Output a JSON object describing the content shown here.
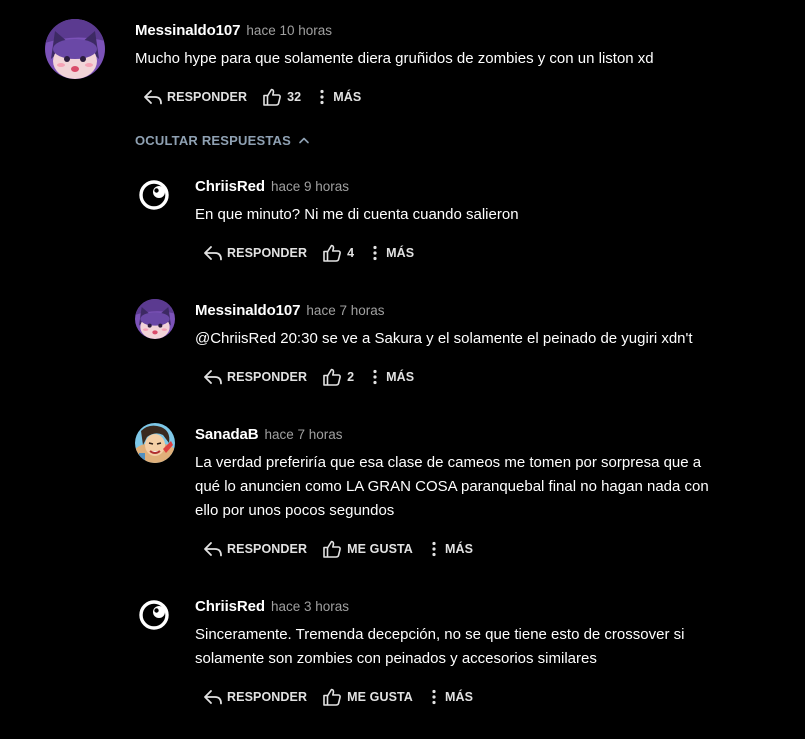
{
  "actions": {
    "reply_label": "RESPONDER",
    "like_label": "ME GUSTA",
    "more_label": "MÁS"
  },
  "toggle_replies": {
    "label": "OCULTAR RESPUESTAS",
    "icon": "chevron-up-icon"
  },
  "comment": {
    "username": "Messinaldo107",
    "time": "hace 10 horas",
    "text": "Mucho hype para que solamente diera gruñidos de zombies y con un liston xd",
    "likes": "32",
    "avatar": "anime-cat-avatar"
  },
  "replies": [
    {
      "username": "ChriisRed",
      "time": "hace 9 horas",
      "lines": [
        "En que minuto? Ni me di cuenta cuando salieron"
      ],
      "likes": "4",
      "avatar": "crunchyroll-logo-avatar"
    },
    {
      "username": "Messinaldo107",
      "time": "hace 7 horas",
      "lines": [
        "@ChriisRed 20:30 se ve a Sakura y el solamente el peinado de yugiri xdn't"
      ],
      "likes": "2",
      "avatar": "anime-cat-avatar"
    },
    {
      "username": "SanadaB",
      "time": "hace 7 horas",
      "lines": [
        "La verdad preferiría que esa clase de cameos me tomen por sorpresa que a",
        "qué lo anuncien como LA GRAN COSA paranquebal final no hagan nada con",
        "ello por unos pocos segundos"
      ],
      "likes": "",
      "avatar": "anime-character-avatar"
    },
    {
      "username": "ChriisRed",
      "time": "hace 3 horas",
      "lines": [
        "Sinceramente. Tremenda decepción, no se que tiene esto de crossover si",
        "solamente son zombies con peinados y accesorios similares"
      ],
      "likes": "",
      "avatar": "crunchyroll-logo-avatar"
    }
  ],
  "colors": {
    "background": "#000000",
    "text": "#ffffff",
    "timestamp": "#a0a0a0",
    "toggle": "#8fa1b3"
  }
}
